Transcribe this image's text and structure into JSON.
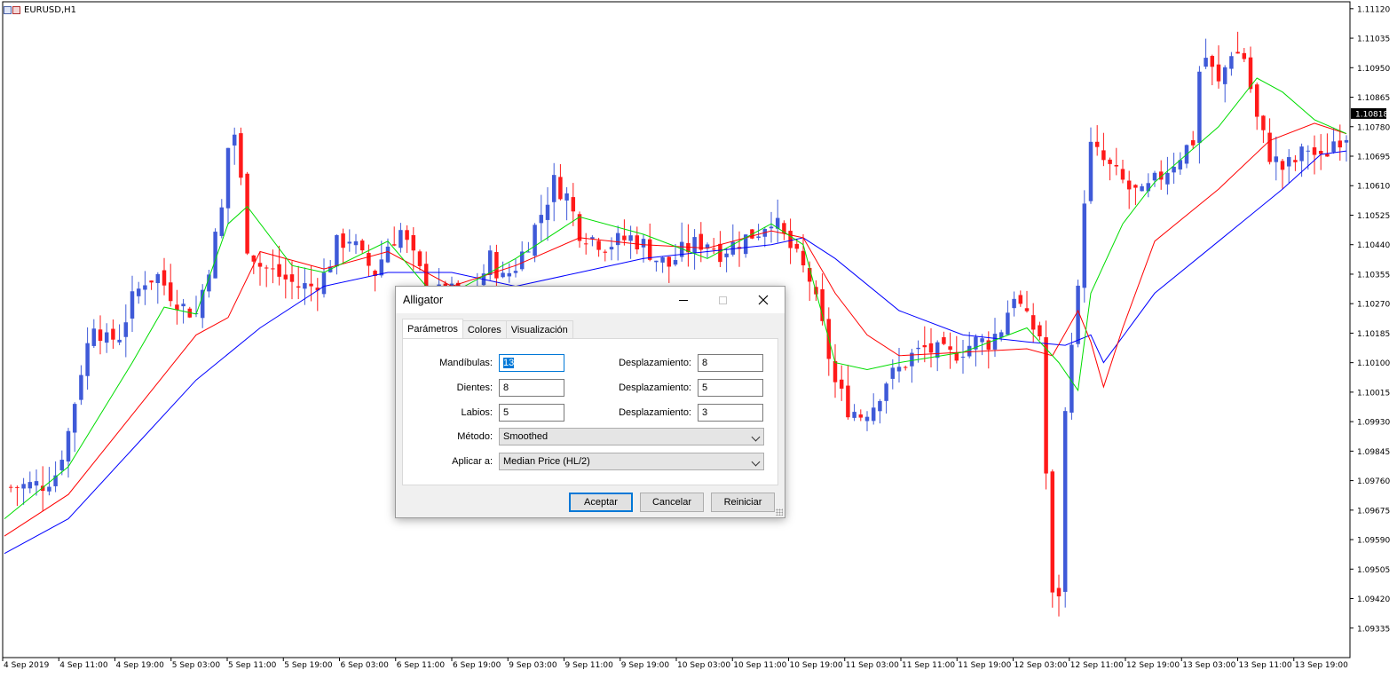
{
  "chart_window": {
    "symbol_title": "EURUSD,H1",
    "current_price": "1.10818",
    "colors": {
      "bull": "#3f5ad8",
      "bear": "#ff1a1a",
      "jaw": "#0000ff",
      "teeth": "#ff0000",
      "lips": "#00dd00",
      "price_tag_bg": "#000000"
    }
  },
  "chart_data": {
    "type": "candlestick",
    "title": "EURUSD,H1",
    "ylim": [
      1.0925,
      1.1114
    ],
    "y_ticks": [
      "1.11120",
      "1.11035",
      "1.10950",
      "1.10865",
      "1.10780",
      "1.10695",
      "1.10610",
      "1.10525",
      "1.10440",
      "1.10355",
      "1.10270",
      "1.10185",
      "1.10100",
      "1.10015",
      "1.09930",
      "1.09845",
      "1.09760",
      "1.09675",
      "1.09590",
      "1.09505",
      "1.09420",
      "1.09335"
    ],
    "x_ticks": [
      "4 Sep 2019",
      "4 Sep 11:00",
      "4 Sep 19:00",
      "5 Sep 03:00",
      "5 Sep 11:00",
      "5 Sep 19:00",
      "6 Sep 03:00",
      "6 Sep 11:00",
      "6 Sep 19:00",
      "9 Sep 03:00",
      "9 Sep 11:00",
      "9 Sep 19:00",
      "10 Sep 03:00",
      "10 Sep 11:00",
      "10 Sep 19:00",
      "11 Sep 03:00",
      "11 Sep 11:00",
      "11 Sep 19:00",
      "12 Sep 03:00",
      "12 Sep 11:00",
      "12 Sep 19:00",
      "13 Sep 03:00",
      "13 Sep 11:00",
      "13 Sep 19:00"
    ],
    "close_path": [
      [
        0,
        1.0974
      ],
      [
        6,
        1.0975
      ],
      [
        8,
        1.0978
      ],
      [
        10,
        1.099
      ],
      [
        12,
        1.1008
      ],
      [
        14,
        1.1022
      ],
      [
        16,
        1.1016
      ],
      [
        18,
        1.1018
      ],
      [
        20,
        1.1028
      ],
      [
        22,
        1.1034
      ],
      [
        24,
        1.1035
      ],
      [
        26,
        1.103
      ],
      [
        28,
        1.1026
      ],
      [
        30,
        1.1024
      ],
      [
        32,
        1.1038
      ],
      [
        34,
        1.1054
      ],
      [
        35,
        1.1072
      ],
      [
        36,
        1.1076
      ],
      [
        37,
        1.1062
      ],
      [
        38,
        1.1044
      ],
      [
        40,
        1.1038
      ],
      [
        42,
        1.1036
      ],
      [
        44,
        1.1034
      ],
      [
        46,
        1.1032
      ],
      [
        48,
        1.1032
      ],
      [
        50,
        1.1035
      ],
      [
        52,
        1.1044
      ],
      [
        54,
        1.1046
      ],
      [
        56,
        1.104
      ],
      [
        58,
        1.1036
      ],
      [
        60,
        1.1044
      ],
      [
        62,
        1.1048
      ],
      [
        64,
        1.104
      ],
      [
        66,
        1.1032
      ],
      [
        68,
        1.103
      ],
      [
        70,
        1.103
      ],
      [
        72,
        1.1025
      ],
      [
        74,
        1.1032
      ],
      [
        76,
        1.104
      ],
      [
        78,
        1.1034
      ],
      [
        80,
        1.1038
      ],
      [
        82,
        1.1045
      ],
      [
        84,
        1.1053
      ],
      [
        86,
        1.1062
      ],
      [
        88,
        1.1058
      ],
      [
        90,
        1.1048
      ],
      [
        92,
        1.1046
      ],
      [
        94,
        1.1044
      ],
      [
        96,
        1.1045
      ],
      [
        98,
        1.1046
      ],
      [
        100,
        1.1044
      ],
      [
        102,
        1.104
      ],
      [
        104,
        1.1038
      ],
      [
        106,
        1.1042
      ],
      [
        108,
        1.1044
      ],
      [
        110,
        1.1045
      ],
      [
        112,
        1.1042
      ],
      [
        114,
        1.1044
      ],
      [
        116,
        1.1046
      ],
      [
        118,
        1.1048
      ],
      [
        120,
        1.1052
      ],
      [
        122,
        1.1046
      ],
      [
        124,
        1.104
      ],
      [
        126,
        1.1034
      ],
      [
        128,
        1.102
      ],
      [
        130,
        1.1004
      ],
      [
        132,
        1.0997
      ],
      [
        134,
        1.0995
      ],
      [
        136,
        1.0998
      ],
      [
        138,
        1.1005
      ],
      [
        140,
        1.1008
      ],
      [
        142,
        1.1012
      ],
      [
        144,
        1.1014
      ],
      [
        146,
        1.1013
      ],
      [
        148,
        1.1012
      ],
      [
        150,
        1.1014
      ],
      [
        152,
        1.1016
      ],
      [
        154,
        1.1016
      ],
      [
        156,
        1.102
      ],
      [
        158,
        1.103
      ],
      [
        160,
        1.1022
      ],
      [
        162,
        1.1018
      ],
      [
        163,
        1.0978
      ],
      [
        164,
        1.0942
      ],
      [
        165,
        1.0944
      ],
      [
        166,
        1.0995
      ],
      [
        167,
        1.1018
      ],
      [
        168,
        1.103
      ],
      [
        169,
        1.1058
      ],
      [
        170,
        1.1072
      ],
      [
        172,
        1.1068
      ],
      [
        174,
        1.1064
      ],
      [
        176,
        1.106
      ],
      [
        178,
        1.1058
      ],
      [
        180,
        1.1062
      ],
      [
        182,
        1.1066
      ],
      [
        184,
        1.107
      ],
      [
        186,
        1.1074
      ],
      [
        187,
        1.1094
      ],
      [
        188,
        1.1098
      ],
      [
        190,
        1.109
      ],
      [
        192,
        1.11
      ],
      [
        194,
        1.1098
      ],
      [
        196,
        1.108
      ],
      [
        198,
        1.107
      ],
      [
        200,
        1.1066
      ],
      [
        202,
        1.1068
      ],
      [
        204,
        1.1072
      ],
      [
        206,
        1.1068
      ],
      [
        208,
        1.1074
      ],
      [
        210,
        1.1076
      ]
    ],
    "indicator": {
      "name": "Alligator",
      "series": [
        {
          "line": "jaw",
          "color": "#0000ff",
          "values": [
            [
              0,
              1.0955
            ],
            [
              10,
              1.0965
            ],
            [
              20,
              1.0985
            ],
            [
              30,
              1.1005
            ],
            [
              40,
              1.102
            ],
            [
              50,
              1.1032
            ],
            [
              60,
              1.1036
            ],
            [
              70,
              1.1036
            ],
            [
              80,
              1.1032
            ],
            [
              90,
              1.1036
            ],
            [
              100,
              1.104
            ],
            [
              110,
              1.1042
            ],
            [
              120,
              1.1044
            ],
            [
              125,
              1.1046
            ],
            [
              130,
              1.104
            ],
            [
              140,
              1.1025
            ],
            [
              150,
              1.1018
            ],
            [
              160,
              1.1016
            ],
            [
              166,
              1.1015
            ],
            [
              170,
              1.1018
            ],
            [
              172,
              1.101
            ],
            [
              174,
              1.1015
            ],
            [
              180,
              1.103
            ],
            [
              190,
              1.1045
            ],
            [
              200,
              1.106
            ],
            [
              206,
              1.107
            ],
            [
              210,
              1.1071
            ]
          ]
        },
        {
          "line": "teeth",
          "color": "#ff0000",
          "values": [
            [
              0,
              1.096
            ],
            [
              10,
              1.0972
            ],
            [
              20,
              1.0995
            ],
            [
              30,
              1.1018
            ],
            [
              35,
              1.1023
            ],
            [
              40,
              1.1042
            ],
            [
              50,
              1.1037
            ],
            [
              60,
              1.1042
            ],
            [
              70,
              1.1032
            ],
            [
              80,
              1.1038
            ],
            [
              90,
              1.1046
            ],
            [
              100,
              1.1044
            ],
            [
              110,
              1.1043
            ],
            [
              120,
              1.1048
            ],
            [
              125,
              1.1046
            ],
            [
              130,
              1.103
            ],
            [
              135,
              1.1018
            ],
            [
              140,
              1.1012
            ],
            [
              150,
              1.1013
            ],
            [
              160,
              1.1014
            ],
            [
              164,
              1.1012
            ],
            [
              168,
              1.1025
            ],
            [
              170,
              1.1016
            ],
            [
              172,
              1.1003
            ],
            [
              175,
              1.102
            ],
            [
              180,
              1.1045
            ],
            [
              190,
              1.106
            ],
            [
              198,
              1.1074
            ],
            [
              205,
              1.1079
            ],
            [
              210,
              1.1076
            ]
          ]
        },
        {
          "line": "lips",
          "color": "#00dd00",
          "values": [
            [
              0,
              1.0965
            ],
            [
              10,
              1.098
            ],
            [
              20,
              1.101
            ],
            [
              25,
              1.1026
            ],
            [
              30,
              1.1024
            ],
            [
              35,
              1.105
            ],
            [
              38,
              1.1055
            ],
            [
              45,
              1.1038
            ],
            [
              50,
              1.1036
            ],
            [
              60,
              1.1045
            ],
            [
              66,
              1.1032
            ],
            [
              70,
              1.103
            ],
            [
              80,
              1.104
            ],
            [
              90,
              1.1052
            ],
            [
              100,
              1.1047
            ],
            [
              110,
              1.104
            ],
            [
              120,
              1.105
            ],
            [
              125,
              1.1044
            ],
            [
              130,
              1.101
            ],
            [
              135,
              1.1008
            ],
            [
              140,
              1.101
            ],
            [
              150,
              1.1013
            ],
            [
              160,
              1.102
            ],
            [
              165,
              1.101
            ],
            [
              168,
              1.1002
            ],
            [
              170,
              1.103
            ],
            [
              175,
              1.105
            ],
            [
              180,
              1.1062
            ],
            [
              190,
              1.1078
            ],
            [
              196,
              1.1092
            ],
            [
              200,
              1.1088
            ],
            [
              205,
              1.108
            ],
            [
              210,
              1.1076
            ]
          ]
        }
      ]
    }
  },
  "dialog": {
    "title": "Alligator",
    "tabs": [
      "Parámetros",
      "Colores",
      "Visualización"
    ],
    "active_tab": "Parámetros",
    "fields": {
      "jaw_label": "Mandíbulas:",
      "jaw_period": "13",
      "teeth_label": "Dientes:",
      "teeth_period": "8",
      "lips_label": "Labios:",
      "lips_period": "5",
      "shift_label": "Desplazamiento:",
      "jaw_shift": "8",
      "teeth_shift": "5",
      "lips_shift": "3",
      "method_label": "Método:",
      "method_value": "Smoothed",
      "apply_label": "Aplicar a:",
      "apply_value": "Median Price (HL/2)"
    },
    "buttons": {
      "ok": "Aceptar",
      "cancel": "Cancelar",
      "reset": "Reiniciar"
    },
    "icons": {
      "minimize": "minimize-icon",
      "maximize": "maximize-icon",
      "close": "close-icon"
    }
  }
}
